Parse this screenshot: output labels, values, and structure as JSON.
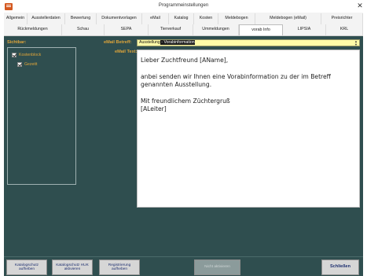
{
  "window": {
    "title": "Programmeinstellungen",
    "close_glyph": "✕"
  },
  "tabs": {
    "row1": [
      "Allgemein",
      "Ausstellerdaten",
      "Bewertung",
      "Dokumentvorlagen",
      "eMail",
      "Katalog",
      "Kosten",
      "Meldebogen",
      "Meldebogen (eMail)",
      "Preisrichter"
    ],
    "row2": [
      "Rückmeldungen",
      "Schau",
      "SEPA",
      "Tierverkauf",
      "Ummeldungen",
      "vorab Info",
      "LIPSIA",
      "KRL"
    ],
    "active": "vorab Info"
  },
  "visibility": {
    "label": "Sichtbar:",
    "items": [
      {
        "label": "Kostenblock",
        "checked": true
      },
      {
        "label": "Gezeitt",
        "checked": true
      }
    ]
  },
  "email": {
    "subject_label": "eMail Betreff:",
    "subject_value_start": "Ausstellung",
    "subject_value_selected": " - Vorabinformation",
    "text_label": "eMail Text:",
    "body": [
      "Lieber Zuchtfreund [AName],",
      "anbei senden wir Ihnen eine Vorabinformation zu der im Betreff genannten Ausstellung.",
      "Mit freundlichem Züchtergruß",
      "[ALeiter]"
    ]
  },
  "buttons": {
    "catalog_protect": "Katalogschutz aufheben",
    "catalog_protect_huk": "Katalogschutz HUK aktivieren",
    "registration": "Registrierung aufheben",
    "disabled": "Nicht aktivieren",
    "close": "Schließen"
  },
  "colors": {
    "panel": "#2f4e4f",
    "label_accent": "#e0a53a",
    "subject_bg": "#fffca8"
  },
  "icons": {
    "app": "app-icon",
    "close": "close-icon",
    "checkbox": "checkbox-checked-icon"
  }
}
